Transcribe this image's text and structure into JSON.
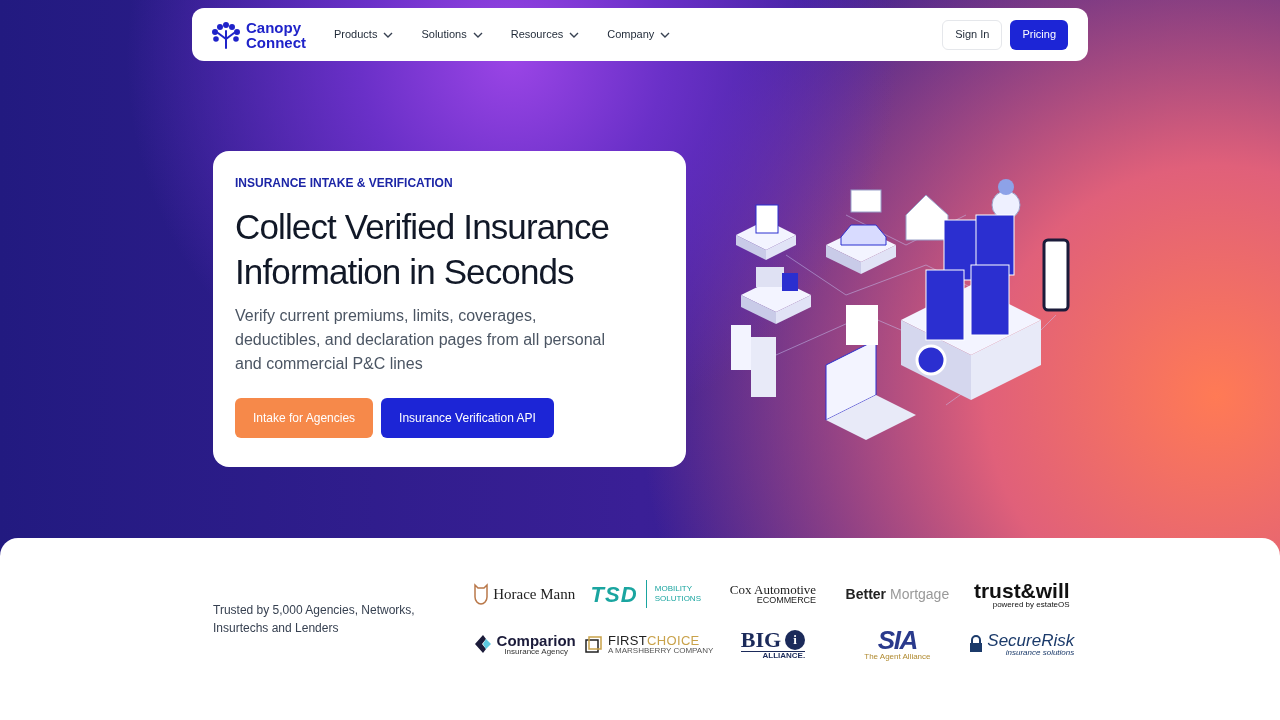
{
  "nav": {
    "logo": {
      "line1": "Canopy",
      "line2": "Connect"
    },
    "menu": [
      {
        "label": "Products",
        "dropdown": true
      },
      {
        "label": "Solutions",
        "dropdown": true
      },
      {
        "label": "Resources",
        "dropdown": true
      },
      {
        "label": "Company",
        "dropdown": true
      }
    ],
    "actions": [
      {
        "label": "Sign In",
        "kind": "outline"
      },
      {
        "label": "Pricing",
        "kind": "primary"
      }
    ]
  },
  "hero": {
    "eyebrow": "INSURANCE INTAKE & VERIFICATION",
    "title": "Collect Verified Insurance Information in Seconds",
    "body": "Verify current premiums, limits, coverages, deductibles, and declaration pages from all personal and commercial P&C lines",
    "buttons": [
      {
        "label": "Intake for Agencies",
        "kind": "orange"
      },
      {
        "label": "Insurance Verification API",
        "kind": "primary"
      }
    ]
  },
  "trusted": {
    "text": "Trusted by 5,000 Agencies, Networks, Insurtechs and Lenders",
    "logos": [
      {
        "kind": "horace",
        "main": "Horace Mann"
      },
      {
        "kind": "tsd",
        "main": "TSD",
        "sub": "MOBILITY SOLUTIONS"
      },
      {
        "kind": "cox",
        "main": "Cox Automotive",
        "sub": "ECOMMERCE"
      },
      {
        "kind": "better",
        "main": "Better",
        "sub": "Mortgage"
      },
      {
        "kind": "trust",
        "main": "trust&will",
        "sub": "powered by estateOS"
      },
      {
        "kind": "comparion",
        "main": "Comparion",
        "sub": "Insurance Agency"
      },
      {
        "kind": "firstchoice",
        "main": "FIRST",
        "sub": "CHOICE",
        "note": "A MARSHBERRY COMPANY"
      },
      {
        "kind": "big",
        "main": "BIG",
        "sub": "i",
        "note": "ALLIANCE."
      },
      {
        "kind": "sia",
        "main": "SIA",
        "sub": "The Agent Alliance"
      },
      {
        "kind": "secure",
        "main": "SecureRisk",
        "sub": "insurance solutions"
      }
    ]
  }
}
